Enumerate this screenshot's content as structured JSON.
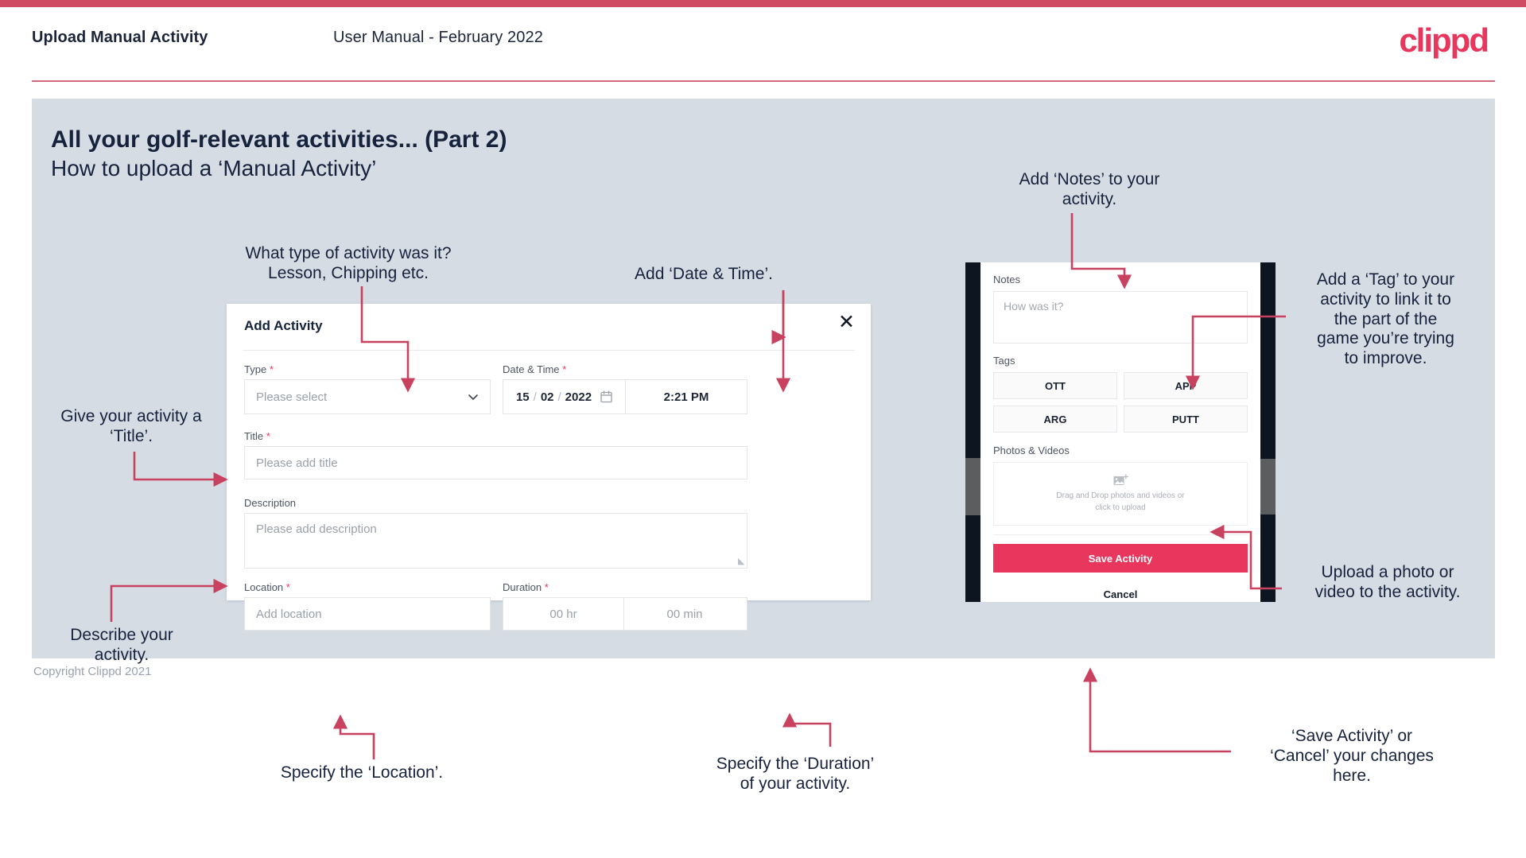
{
  "header": {
    "title": "Upload Manual Activity",
    "subtitle": "User Manual - February 2022",
    "logo": "clippd"
  },
  "slide": {
    "heading": "All your golf-relevant activities... (Part 2)",
    "subheading": "How to upload a ‘Manual Activity’"
  },
  "footer": {
    "copyright": "Copyright Clippd 2021"
  },
  "annotations": {
    "type": "What type of activity was it?\nLesson, Chipping etc.",
    "datetime": "Add ‘Date & Time’.",
    "title": "Give your activity a\n‘Title’.",
    "description": "Describe your\nactivity.",
    "location": "Specify the ‘Location’.",
    "duration": "Specify the ‘Duration’\nof your activity.",
    "notes": "Add ‘Notes’ to your\nactivity.",
    "tags": "Add a ‘Tag’ to your\nactivity to link it to\nthe part of the\ngame you’re trying\nto improve.",
    "photos": "Upload a photo or\nvideo to the activity.",
    "save": "‘Save Activity’ or\n‘Cancel’ your changes\nhere."
  },
  "dialog": {
    "title": "Add Activity",
    "close_icon": "close-icon",
    "fields": {
      "type": {
        "label": "Type",
        "required": "*",
        "placeholder": "Please select"
      },
      "datetime": {
        "label": "Date & Time",
        "required": "*",
        "day": "15",
        "month": "02",
        "year": "2022",
        "sep": "/",
        "time": "2:21 PM"
      },
      "title": {
        "label": "Title",
        "required": "*",
        "placeholder": "Please add title"
      },
      "description": {
        "label": "Description",
        "required": "",
        "placeholder": "Please add description"
      },
      "location": {
        "label": "Location",
        "required": "*",
        "placeholder": "Add location"
      },
      "duration": {
        "label": "Duration",
        "required": "*",
        "hours": "00 hr",
        "minutes": "00 min"
      }
    }
  },
  "phone": {
    "notes": {
      "label": "Notes",
      "placeholder": "How was it?"
    },
    "tags": {
      "label": "Tags",
      "items": [
        "OTT",
        "APP",
        "ARG",
        "PUTT"
      ]
    },
    "photos": {
      "label": "Photos & Videos",
      "drop_line1": "Drag and Drop photos and videos or",
      "drop_line2": "click to upload",
      "icon": "add-image-icon"
    },
    "save_label": "Save Activity",
    "cancel_label": "Cancel"
  },
  "colors": {
    "brand": "#e8365d",
    "accent_rule": "#cf4a63",
    "arrow": "#c8415e",
    "slide_bg": "#d5dce4",
    "text_dark": "#17223c"
  }
}
